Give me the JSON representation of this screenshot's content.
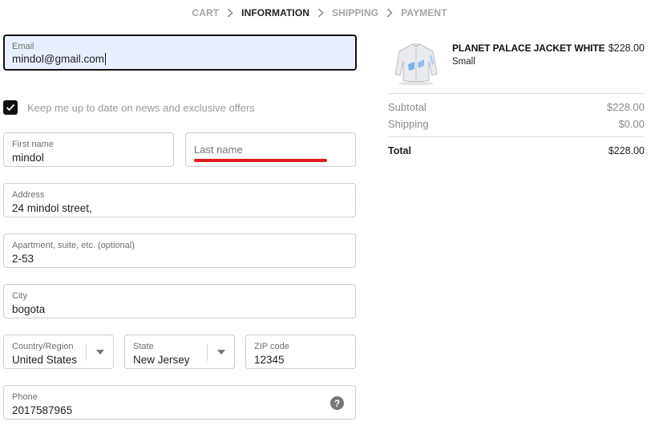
{
  "breadcrumb": {
    "steps": [
      "CART",
      "INFORMATION",
      "SHIPPING",
      "PAYMENT"
    ],
    "active": "INFORMATION"
  },
  "contact": {
    "email_label": "Email",
    "email_value": "mindol@gmail.com",
    "newsletter_label": "Keep me up to date on news and exclusive offers",
    "newsletter_checked": true
  },
  "address": {
    "first_name_label": "First name",
    "first_name_value": "mindol",
    "last_name_placeholder": "Last name",
    "address_label": "Address",
    "address_value": "24 mindol street,",
    "apartment_label": "Apartment, suite, etc. (optional)",
    "apartment_value": "2-53",
    "city_label": "City",
    "city_value": "bogota",
    "country_label": "Country/Region",
    "country_value": "United States",
    "state_label": "State",
    "state_value": "New Jersey",
    "zip_label": "ZIP code",
    "zip_value": "12345",
    "phone_label": "Phone",
    "phone_value": "2017587965",
    "phone_help_icon": "question-mark-icon"
  },
  "summary": {
    "product_name": "PLANET PALACE JACKET WHITE",
    "product_variant": "Small",
    "product_price": "$228.00",
    "subtotal_label": "Subtotal",
    "subtotal_value": "$228.00",
    "shipping_label": "Shipping",
    "shipping_value": "$0.00",
    "total_label": "Total",
    "total_value": "$228.00"
  },
  "colors": {
    "focus_bg": "#e8efff",
    "error_underline": "#e11b22",
    "muted": "#a5a5a5"
  }
}
